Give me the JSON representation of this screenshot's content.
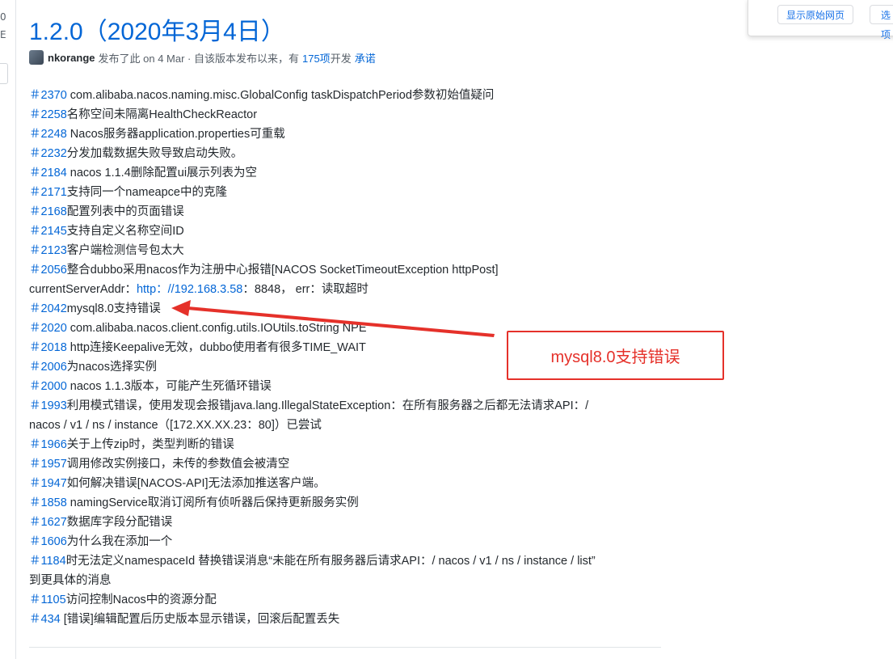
{
  "left_rail": {
    "frag_top": "0",
    "frag_mid": "E"
  },
  "translate_bar": {
    "show_original_label": "显示原始网页",
    "options_label": "选项"
  },
  "release": {
    "title": "1.2.0（2020年3月4日）",
    "author": "nkorange",
    "published_text": "发布了此 on 4 Mar · 自该版本发布以来，有",
    "commits_link": "175项",
    "commits_suffix": "开发",
    "commitment_link": "承诺"
  },
  "notes": [
    {
      "num": "2370",
      "text": " com.alibaba.nacos.naming.misc.GlobalConfig taskDispatchPeriod参数初始值疑问"
    },
    {
      "num": "2258",
      "text": "名称空间未隔离HealthCheckReactor"
    },
    {
      "num": "2248",
      "text": " Nacos服务器application.properties可重载"
    },
    {
      "num": "2232",
      "text": "分发加载数据失败导致启动失败。"
    },
    {
      "num": "2184",
      "text": " nacos 1.1.4删除配置ui展示列表为空"
    },
    {
      "num": "2171",
      "text": "支持同一个nameapce中的克隆"
    },
    {
      "num": "2168",
      "text": "配置列表中的页面错误"
    },
    {
      "num": "2145",
      "text": "支持自定义名称空间ID"
    },
    {
      "num": "2123",
      "text": "客户端检测信号包太大"
    },
    {
      "num": "2056",
      "text": "整合dubbo采用nacos作为注册中心报错[NACOS SocketTimeoutException httpPost]"
    },
    {
      "num": "",
      "text_before": "currentServerAddr：",
      "link": "http：//192.168.3.58",
      "text_after": "：8848， err：读取超时"
    },
    {
      "num": "2042",
      "text": "mysql8.0支持错误"
    },
    {
      "num": "2020",
      "text": " com.alibaba.nacos.client.config.utils.IOUtils.toString NPE"
    },
    {
      "num": "2018",
      "text": " http连接Keepalive无效，dubbo使用者有很多TIME_WAIT"
    },
    {
      "num": "2006",
      "text": "为nacos选择实例"
    },
    {
      "num": "2000",
      "text": " nacos 1.1.3版本，可能产生死循环错误"
    },
    {
      "num": "1993",
      "text": "利用模式错误，使用发现会报错java.lang.IllegalStateException：在所有服务器之后都无法请求API：/"
    },
    {
      "num": "",
      "text": "nacos / v1 / ns / instance（[172.XX.XX.23：80]）已尝试"
    },
    {
      "num": "1966",
      "text": "关于上传zip时，类型判断的错误"
    },
    {
      "num": "1957",
      "text": "调用修改实例接口，未传的参数值会被清空"
    },
    {
      "num": "1947",
      "text": "如何解决错误[NACOS-API]无法添加推送客户端。"
    },
    {
      "num": "1858",
      "text": " namingService取消订阅所有侦听器后保持更新服务实例"
    },
    {
      "num": "1627",
      "text": "数据库字段分配错误"
    },
    {
      "num": "1606",
      "text": "为什么我在添加一个"
    },
    {
      "num": "1184",
      "text": "时无法定义namespaceId 替换错误消息“未能在所有服务器后请求API：/ nacos / v1 / ns / instance / list”"
    },
    {
      "num": "",
      "text": "到更具体的消息"
    },
    {
      "num": "1105",
      "text": "访问控制Nacos中的资源分配"
    },
    {
      "num": "434",
      "text": " [错误]编辑配置后历史版本显示错误，回滚后配置丢失"
    }
  ],
  "callout": {
    "text": "mysql8.0支持错误",
    "color": "#e5312a"
  },
  "colors": {
    "link": "#0366d6",
    "text": "#24292e",
    "muted": "#586069"
  }
}
